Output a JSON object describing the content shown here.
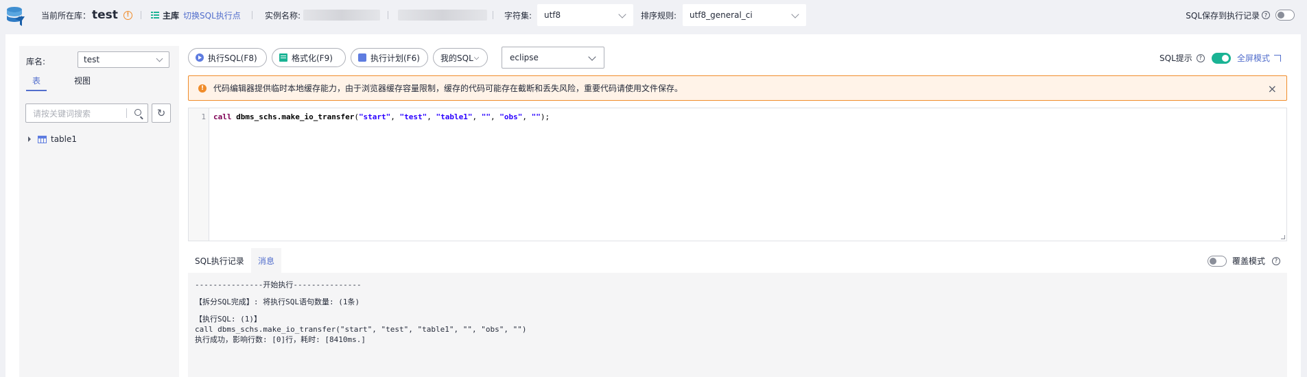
{
  "topbar": {
    "current_db_label": "当前所在库：",
    "current_db_name": "test",
    "info_icon": "!",
    "master_label": "主库",
    "switch_link": "切换SQL执行点",
    "instance_label": "实例名称:",
    "charset_label": "字符集:",
    "charset_value": "utf8",
    "collation_label": "排序规则:",
    "collation_value": "utf8_general_ci",
    "save_history_label": "SQL保存到执行记录",
    "help_icon": "?"
  },
  "sidebar": {
    "db_label": "库名:",
    "db_value": "test",
    "tabs": [
      {
        "label": "表"
      },
      {
        "label": "视图"
      }
    ],
    "search_placeholder": "请按关键词搜索",
    "refresh_icon": "↻",
    "tree": [
      {
        "label": "table1"
      }
    ]
  },
  "toolbar": {
    "execute": "执行SQL(F8)",
    "format": "格式化(F9)",
    "plan": "执行计划(F6)",
    "my_sql": "我的SQL",
    "my_sql_chevron": "⌵",
    "theme": "eclipse",
    "sql_hint": "SQL提示",
    "help_icon": "?",
    "fullscreen": "全屏模式"
  },
  "warning": {
    "icon": "!",
    "text": "代码编辑器提供临时本地缓存能力，由于浏览器缓存容量限制，缓存的代码可能存在截断和丢失风险，重要代码请使用文件保存。",
    "close": "×"
  },
  "editor": {
    "line_number": "1",
    "keyword": "call",
    "function": "dbms_schs.make_io_transfer",
    "open_paren": "(",
    "args": [
      "\"start\"",
      "\"test\"",
      "\"table1\"",
      "\"\"",
      "\"obs\"",
      "\"\""
    ],
    "comma": ", ",
    "close": ");"
  },
  "output": {
    "tabs": [
      {
        "label": "SQL执行记录"
      },
      {
        "label": "消息"
      }
    ],
    "cover_mode": "覆盖模式",
    "help_icon": "?",
    "lines": [
      "---------------开始执行---------------",
      "【拆分SQL完成】: 将执行SQL语句数量: (1条)",
      "【执行SQL: (1)】",
      "call dbms_schs.make_io_transfer(\"start\", \"test\", \"table1\", \"\", \"obs\", \"\")",
      "执行成功，影响行数: [0]行，耗时: [8410ms.]"
    ]
  }
}
